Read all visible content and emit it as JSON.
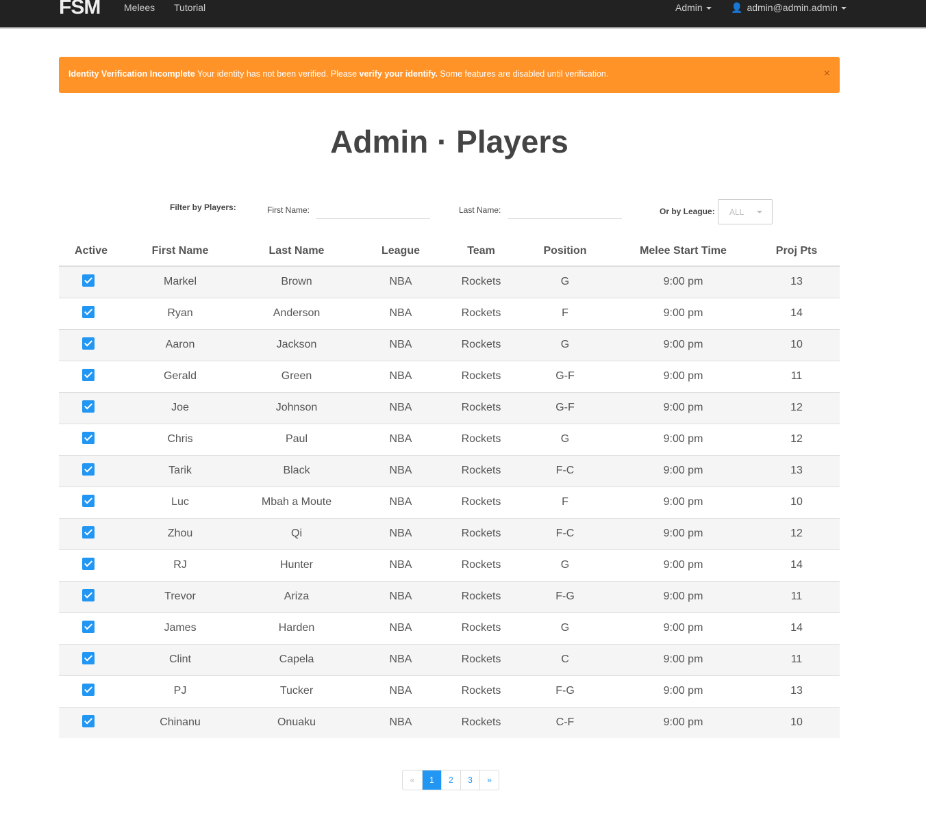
{
  "nav": {
    "logo": "FSM",
    "links": [
      "Melees",
      "Tutorial"
    ],
    "admin": "Admin",
    "user": "admin@admin.admin"
  },
  "alert": {
    "title": "Identity Verification Incomplete",
    "text1": " Your identity has not been verified. Please ",
    "link": "verify your identify.",
    "text2": " Some features are disabled until verification.",
    "close": "×"
  },
  "title": "Admin · Players",
  "filter": {
    "label": "Filter by Players:",
    "first_name": "First Name:",
    "last_name": "Last Name:",
    "league_label": "Or by League:",
    "league_value": "ALL"
  },
  "table": {
    "headers": [
      "Active",
      "First Name",
      "Last Name",
      "League",
      "Team",
      "Position",
      "Melee Start Time",
      "Proj Pts"
    ],
    "rows": [
      [
        "Markel",
        "Brown",
        "NBA",
        "Rockets",
        "G",
        "9:00 pm",
        "13"
      ],
      [
        "Ryan",
        "Anderson",
        "NBA",
        "Rockets",
        "F",
        "9:00 pm",
        "14"
      ],
      [
        "Aaron",
        "Jackson",
        "NBA",
        "Rockets",
        "G",
        "9:00 pm",
        "10"
      ],
      [
        "Gerald",
        "Green",
        "NBA",
        "Rockets",
        "G-F",
        "9:00 pm",
        "11"
      ],
      [
        "Joe",
        "Johnson",
        "NBA",
        "Rockets",
        "G-F",
        "9:00 pm",
        "12"
      ],
      [
        "Chris",
        "Paul",
        "NBA",
        "Rockets",
        "G",
        "9:00 pm",
        "12"
      ],
      [
        "Tarik",
        "Black",
        "NBA",
        "Rockets",
        "F-C",
        "9:00 pm",
        "13"
      ],
      [
        "Luc",
        "Mbah a Moute",
        "NBA",
        "Rockets",
        "F",
        "9:00 pm",
        "10"
      ],
      [
        "Zhou",
        "Qi",
        "NBA",
        "Rockets",
        "F-C",
        "9:00 pm",
        "12"
      ],
      [
        "RJ",
        "Hunter",
        "NBA",
        "Rockets",
        "G",
        "9:00 pm",
        "14"
      ],
      [
        "Trevor",
        "Ariza",
        "NBA",
        "Rockets",
        "F-G",
        "9:00 pm",
        "11"
      ],
      [
        "James",
        "Harden",
        "NBA",
        "Rockets",
        "G",
        "9:00 pm",
        "14"
      ],
      [
        "Clint",
        "Capela",
        "NBA",
        "Rockets",
        "C",
        "9:00 pm",
        "11"
      ],
      [
        "PJ",
        "Tucker",
        "NBA",
        "Rockets",
        "F-G",
        "9:00 pm",
        "13"
      ],
      [
        "Chinanu",
        "Onuaku",
        "NBA",
        "Rockets",
        "C-F",
        "9:00 pm",
        "10"
      ]
    ],
    "active": true
  },
  "pagination": {
    "prev": "«",
    "pages": [
      "1",
      "2",
      "3"
    ],
    "current": "1",
    "next": "»"
  },
  "colors": {
    "accent": "#2196f3",
    "alert": "#ff9328",
    "navbar": "#222222"
  }
}
